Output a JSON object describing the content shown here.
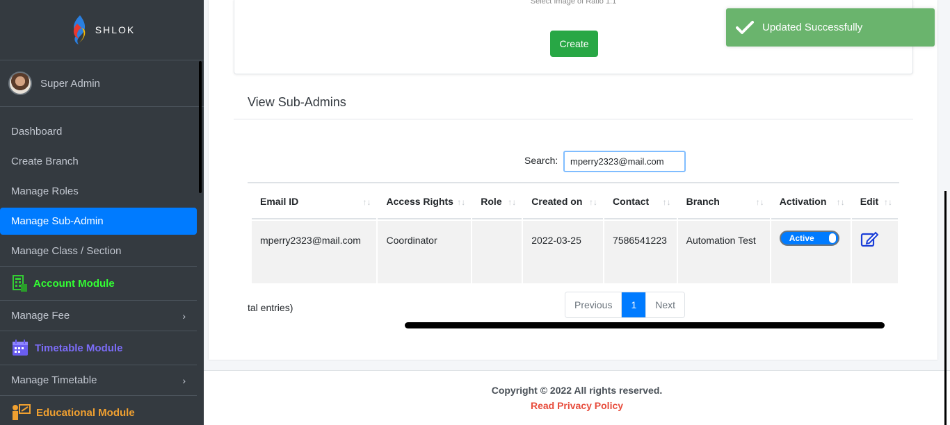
{
  "brand": {
    "name": "SHLOK"
  },
  "user": {
    "name": "Super Admin"
  },
  "nav": {
    "dashboard": "Dashboard",
    "create_branch": "Create Branch",
    "manage_roles": "Manage Roles",
    "manage_sub_admin": "Manage Sub-Admin",
    "manage_class": "Manage Class / Section",
    "account_module": "Account Module",
    "manage_fee": "Manage Fee",
    "timetable_module": "Timetable Module",
    "manage_timetable": "Manage Timetable",
    "educational_module": "Educational Module"
  },
  "colors": {
    "account_module": "#33ff33",
    "timetable_module": "#7b6cf6",
    "educational_module": "#f0a030",
    "active": "#007bff"
  },
  "create_card": {
    "hint": "Select Image of Ratio 1:1",
    "create_button": "Create"
  },
  "view": {
    "title": "View Sub-Admins",
    "search_label": "Search:",
    "search_value": "mperry2323@mail.com"
  },
  "table": {
    "headers": [
      "Email ID",
      "Access Rights",
      "Role",
      "Created on",
      "Contact",
      "Branch",
      "Activation",
      "Edit"
    ],
    "row": {
      "email": "mperry2323@mail.com",
      "access_rights": "Coordinator",
      "role": "",
      "created_on": "2022-03-25",
      "contact": "7586541223",
      "branch": "Automation Test",
      "activation": "Active"
    }
  },
  "entries_text": "tal entries)",
  "pagination": {
    "previous": "Previous",
    "page": "1",
    "next": "Next"
  },
  "footer": {
    "copyright": "Copyright © 2022 All rights reserved.",
    "privacy": "Read Privacy Policy"
  },
  "toast": {
    "message": "Updated Successfully"
  }
}
